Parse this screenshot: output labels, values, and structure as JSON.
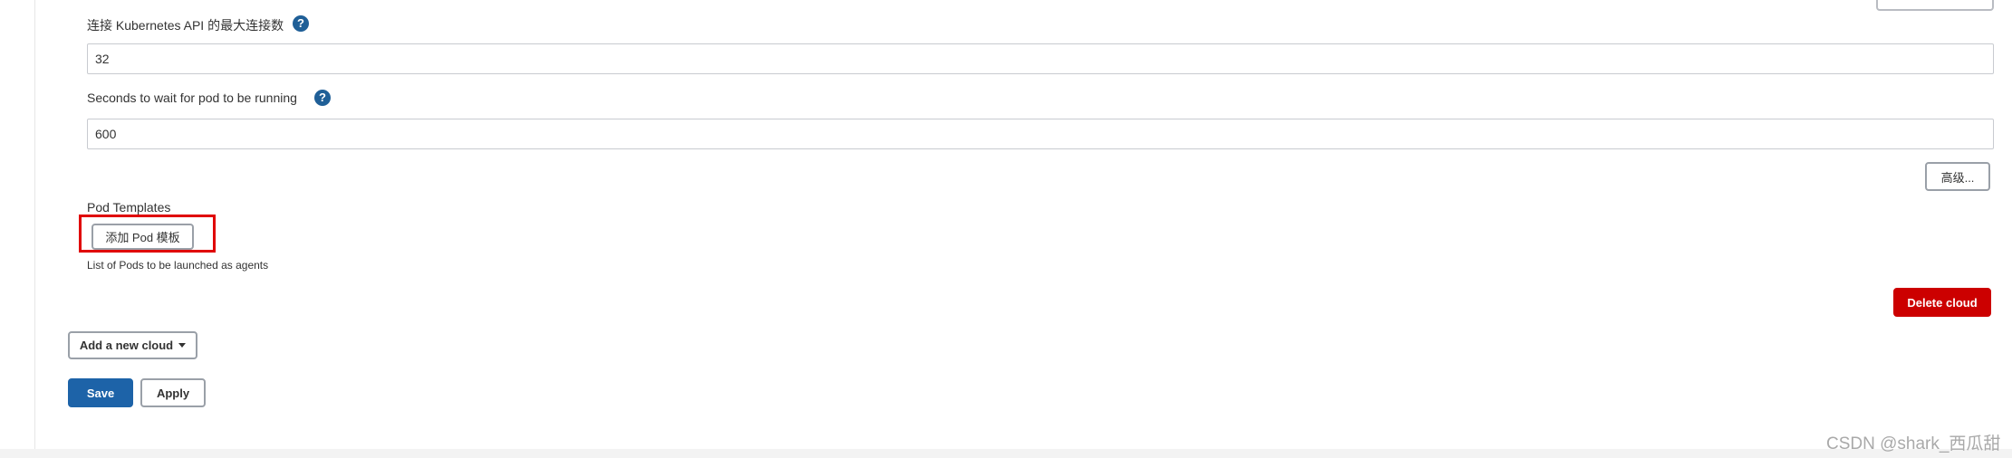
{
  "fields": {
    "max_connections": {
      "label": "连接 Kubernetes API 的最大连接数",
      "help": "?",
      "value": "32"
    },
    "pod_wait": {
      "label": "Seconds to wait for pod to be running",
      "help": "?",
      "value": "600"
    }
  },
  "advanced_button": "高级...",
  "pod_templates": {
    "title": "Pod Templates",
    "add_button": "添加 Pod 模板",
    "description": "List of Pods to be launched as agents"
  },
  "delete_cloud_button": "Delete cloud",
  "add_cloud_button": "Add a new cloud",
  "save_button": "Save",
  "apply_button": "Apply",
  "watermark": "CSDN @shark_西瓜甜",
  "colors": {
    "primary": "#1d63a8",
    "danger": "#cc0000",
    "help_icon": "#1f5f97",
    "highlight": "#e00000"
  }
}
